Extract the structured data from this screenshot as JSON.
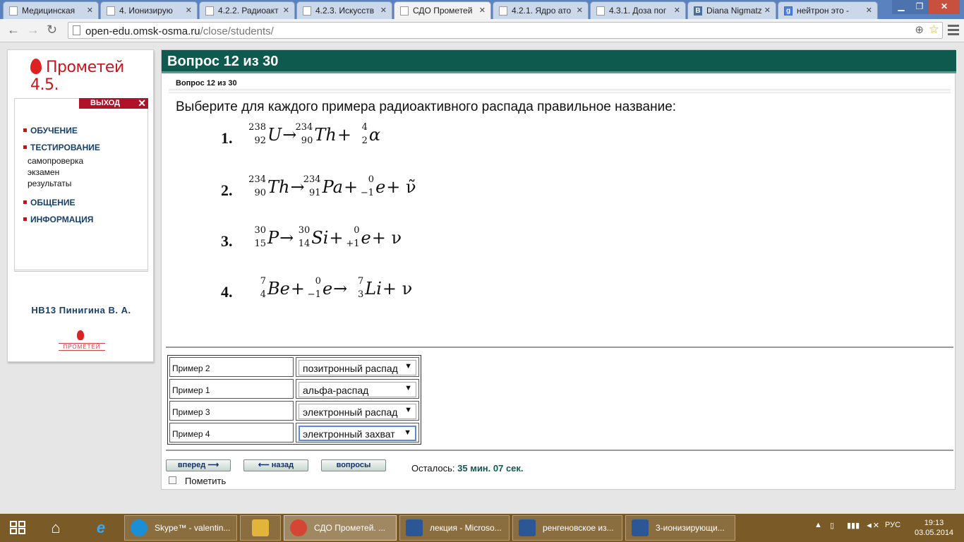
{
  "browser": {
    "tabs": [
      {
        "title": "Медицинская",
        "favicon": "page-icon"
      },
      {
        "title": "4. Ионизирую",
        "favicon": "page-icon"
      },
      {
        "title": "4.2.2. Радиоакт",
        "favicon": "page-icon"
      },
      {
        "title": "4.2.3. Искусств",
        "favicon": "page-icon"
      },
      {
        "title": "СДО Прометей",
        "favicon": "page-icon"
      },
      {
        "title": "4.2.1. Ядро ато",
        "favicon": "page-icon"
      },
      {
        "title": "4.3.1. Доза пог",
        "favicon": "page-icon"
      },
      {
        "title": "Diana Nigmatz",
        "favicon": "vk-icon"
      },
      {
        "title": "нейтрон это -",
        "favicon": "google-icon"
      }
    ],
    "active_tab_index": 4,
    "url_host": "open-edu.omsk-osma.ru",
    "url_path": "/close/students/"
  },
  "sidebar": {
    "logo_text": "Прометей 4.5.",
    "logout_label": "ВЫХОД",
    "menu": {
      "item1": "ОБУЧЕНИЕ",
      "item2": "ТЕСТИРОВАНИЕ",
      "sub1": "самопроверка",
      "sub2": "экзамен",
      "sub3": "результаты",
      "item3": "ОБЩЕНИЕ",
      "item4": "ИНФОРМАЦИЯ"
    },
    "user_name": "НВ13 Пинигина В. А.",
    "footer_logo_text": "ПРОМЕТЕЙ"
  },
  "question": {
    "header": "Вопрос 12 из 30",
    "subheader": "Вопрос 12 из 30",
    "text": "Выберите для каждого примера радиоактивного распада правильное название:",
    "equations": [
      {
        "num": "1.",
        "parts": [
          [
            "238",
            "92",
            "U"
          ],
          "→",
          [
            "234",
            "90",
            "Th"
          ],
          "+",
          [
            "4",
            "2",
            "α"
          ]
        ]
      },
      {
        "num": "2.",
        "parts": [
          [
            "234",
            "90",
            "Th"
          ],
          "→",
          [
            "234",
            "91",
            "Pa"
          ],
          "+",
          [
            "0",
            "−1",
            "e"
          ],
          "+ ν̃"
        ]
      },
      {
        "num": "3.",
        "parts": [
          [
            "30",
            "15",
            "P"
          ],
          "→",
          [
            "30",
            "14",
            "Si"
          ],
          "+",
          [
            "0",
            "+1",
            "e"
          ],
          "+ ν"
        ]
      },
      {
        "num": "4.",
        "parts": [
          [
            "7",
            "4",
            "Be"
          ],
          "+",
          [
            "0",
            "−1",
            "e"
          ],
          "→",
          [
            "7",
            "3",
            "Li"
          ],
          "+ ν"
        ]
      }
    ]
  },
  "answers": [
    {
      "label": "Пример 2",
      "value": "позитронный распад",
      "focused": false
    },
    {
      "label": "Пример 1",
      "value": "альфа-распад",
      "focused": false
    },
    {
      "label": "Пример 3",
      "value": "электронный распад",
      "focused": false
    },
    {
      "label": "Пример 4",
      "value": "электронный захват",
      "focused": true
    }
  ],
  "controls": {
    "next_label": "вперед",
    "back_label": "назад",
    "questions_label": "вопросы",
    "remaining_label": "Осталось:",
    "remaining_time": "35 мин. 07 сек.",
    "mark_label": "Пометить"
  },
  "taskbar": {
    "tasks": [
      {
        "label": "Skype™ - valentin...",
        "icon": "skype-icon",
        "color": "#1a8fd6"
      },
      {
        "label": "",
        "icon": "folder-icon",
        "color": "#e2b53a"
      },
      {
        "label": "СДО Прометей. ...",
        "icon": "chrome-icon",
        "color": "#d44535"
      },
      {
        "label": "лекция - Microso...",
        "icon": "word-icon",
        "color": "#2b5797"
      },
      {
        "label": "ренгеновское из...",
        "icon": "word-icon",
        "color": "#2b5797"
      },
      {
        "label": "3-ионизирующи...",
        "icon": "word-icon",
        "color": "#2b5797"
      }
    ],
    "language": "РУС",
    "time": "19:13",
    "date": "03.05.2014"
  }
}
